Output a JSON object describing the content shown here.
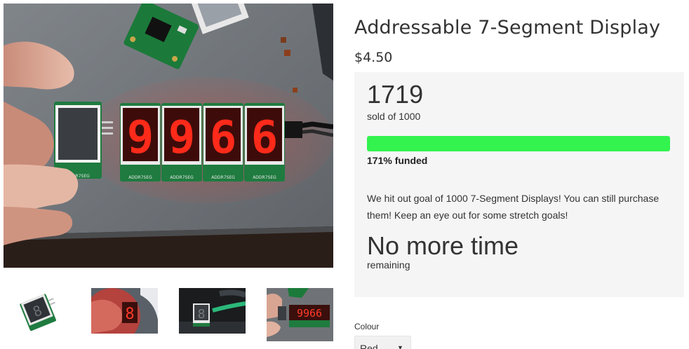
{
  "product": {
    "title": "Addressable 7-Segment Display",
    "price": "$4.50"
  },
  "main_photo": {
    "alt": "Addressable 7-Segment Display",
    "display_digits": "9966",
    "board_label": "ADDR7SEG"
  },
  "thumbnails": [
    {
      "name": "thumbnail-1",
      "digits": "8"
    },
    {
      "name": "thumbnail-2",
      "digits": "8"
    },
    {
      "name": "thumbnail-3",
      "digits": "8"
    },
    {
      "name": "thumbnail-4",
      "digits": "9966"
    }
  ],
  "funding": {
    "sold_count": "1719",
    "sold_caption": "sold of 1000",
    "progress_percent": 171,
    "funded_label": "171% funded",
    "description": "We hit out goal of 1000 7-Segment Displays! You can still purchase them! Keep an eye out for some stretch goals!",
    "time_status": "No more time",
    "time_caption": "remaining"
  },
  "variant": {
    "label": "Colour",
    "selected": "Red"
  },
  "colors": {
    "progress_fill": "#33f34f",
    "panel_background": "#f5f5f6",
    "text": "#333333",
    "segment_red": "#ff2a1a"
  },
  "icons": {
    "select_arrow": "chevron-down-icon"
  }
}
